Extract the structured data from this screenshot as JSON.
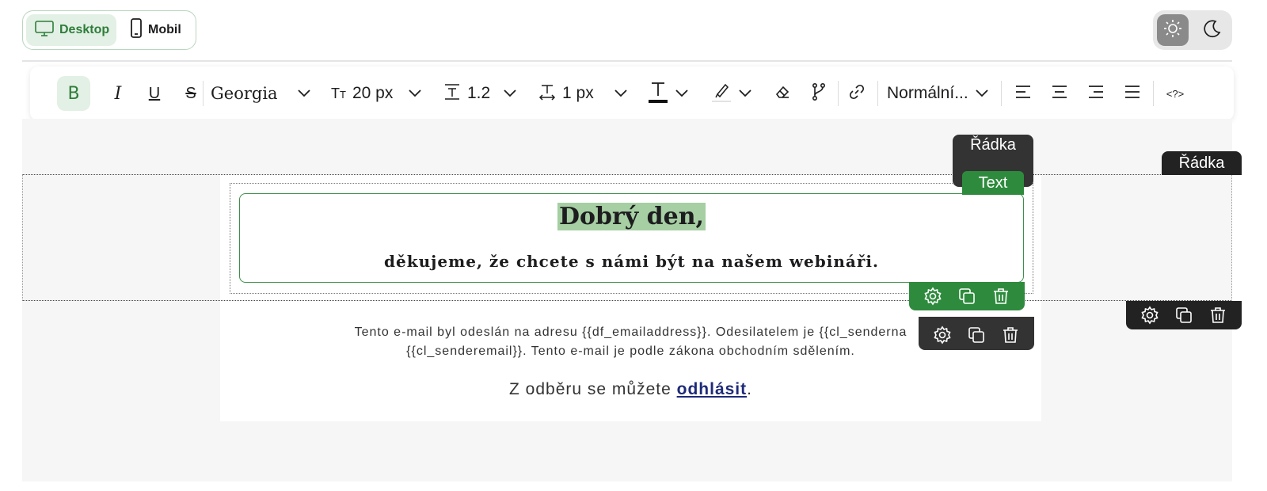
{
  "view_toggle": {
    "desktop_label": "Desktop",
    "mobile_label": "Mobil",
    "selected": "Desktop"
  },
  "theme_toggle": {
    "light_icon": "sun-icon",
    "dark_icon": "moon-icon",
    "selected": "light"
  },
  "toolbar": {
    "font_family": "Georgia",
    "font_size": "20 px",
    "line_height": "1.2",
    "letter_spacing": "1 px",
    "paragraph_style": "Normální...",
    "icons": [
      "bold-icon",
      "italic-icon",
      "underline-icon",
      "strikethrough-icon",
      "font-size-icon",
      "line-height-icon",
      "letter-spacing-icon",
      "text-color-icon",
      "highlight-icon",
      "eraser-icon",
      "merge-tag-icon",
      "link-icon",
      "align-left-icon",
      "align-center-icon",
      "align-right-icon",
      "align-justify-icon",
      "code-icon"
    ]
  },
  "badges": {
    "row_inner": "Řádka",
    "text": "Text",
    "row_outer": "Řádka"
  },
  "email": {
    "greeting": "Dobrý den,",
    "subline": "děkujeme, že chcete s námi být na našem webináři.",
    "footer_line1": "Tento e-mail byl odeslán na adresu {{df_emailaddress}}. Odesilatelem je {{cl_senderna",
    "footer_line2": "{{cl_senderemail}}. Tento e-mail je podle zákona obchodním sdělením.",
    "unsubscribe_prefix": "Z odběru se můžete ",
    "unsubscribe_link": "odhlásit",
    "unsubscribe_suffix": "."
  },
  "colors": {
    "accent": "#2e8b3d",
    "highlight": "#a6cfa3",
    "dark_badge": "#333333"
  }
}
